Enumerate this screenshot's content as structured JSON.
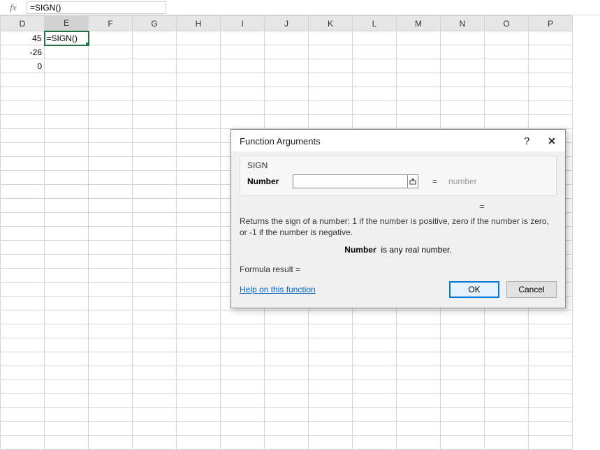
{
  "formula_bar": {
    "fx": "fx",
    "value": "=SIGN()"
  },
  "columns": [
    "D",
    "E",
    "F",
    "G",
    "H",
    "I",
    "J",
    "K",
    "L",
    "M",
    "N",
    "O",
    "P"
  ],
  "active_col_index": 1,
  "cells": {
    "D": [
      "45",
      "-26",
      "0"
    ],
    "E_active": "=SIGN()"
  },
  "dialog": {
    "title": "Function Arguments",
    "help_glyph": "?",
    "close_glyph": "✕",
    "func_name": "SIGN",
    "arg_label": "Number",
    "arg_value": "",
    "arg_preview": "number",
    "eq": "=",
    "result_eq": "=",
    "description": "Returns the sign of a number: 1 if the number is positive, zero if the number is zero, or -1 if the number is negative.",
    "arg_desc_label": "Number",
    "arg_desc_text": "is any real number.",
    "formula_result_label": "Formula result =",
    "help_link": "Help on this function",
    "ok": "OK",
    "cancel": "Cancel"
  }
}
